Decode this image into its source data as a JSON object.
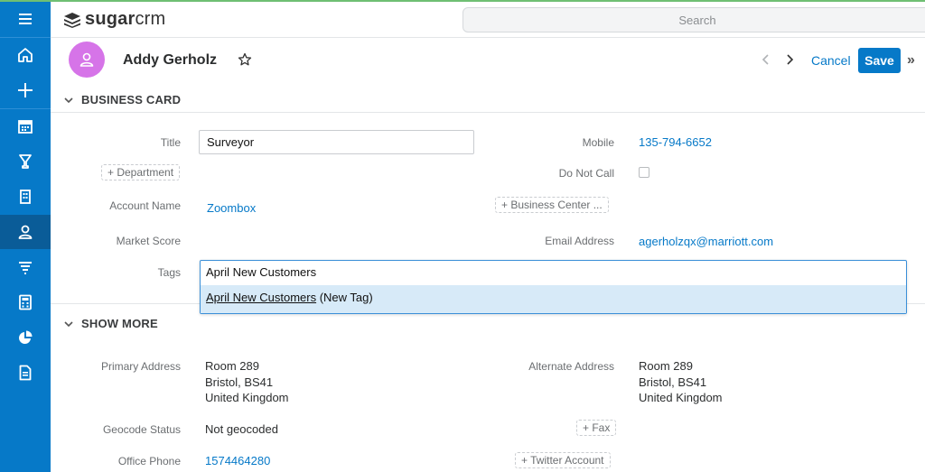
{
  "header": {
    "logo_text_bold": "sugar",
    "logo_text": "crm",
    "search_placeholder": "Search"
  },
  "sidebar": {
    "items": [
      {
        "icon": "menu-icon"
      },
      {
        "icon": "home-icon"
      },
      {
        "icon": "plus-icon"
      },
      {
        "icon": "calendar-icon"
      },
      {
        "icon": "opportunities-icon"
      },
      {
        "icon": "building-icon"
      },
      {
        "icon": "contacts-icon",
        "active": true
      },
      {
        "icon": "filter-icon"
      },
      {
        "icon": "calculator-icon"
      },
      {
        "icon": "pie-chart-icon"
      },
      {
        "icon": "document-icon"
      }
    ],
    "active_color": "#0a5c98",
    "bg_color": "#0679c8"
  },
  "record": {
    "name": "Addy Gerholz",
    "cancel_label": "Cancel",
    "save_label": "Save",
    "more_label": "»"
  },
  "business_card": {
    "section_title": "BUSINESS CARD",
    "title_label": "Title",
    "title_value": "Surveyor",
    "mobile_label": "Mobile",
    "mobile_value": "135-794-6652",
    "department_pill": "+ Department",
    "do_not_call_label": "Do Not Call",
    "account_name_label": "Account Name",
    "account_name_value": "Zoombox",
    "business_center_pill": "+ Business Center ...",
    "market_score_label": "Market Score",
    "email_label": "Email Address",
    "email_value": "agerholzqx@marriott.com",
    "tags_label": "Tags",
    "tags_input_value": "April New Customers",
    "tags_option_text": "April New Customers",
    "tags_option_suffix": " (New Tag)"
  },
  "show_more": {
    "section_title": "SHOW MORE",
    "primary_address_label": "Primary Address",
    "primary_address_line1": "Room 289",
    "primary_address_line2": "Bristol, BS41",
    "primary_address_line3": "United Kingdom",
    "alternate_address_label": "Alternate Address",
    "alternate_address_line1": "Room 289",
    "alternate_address_line2": "Bristol, BS41",
    "alternate_address_line3": "United Kingdom",
    "geocode_label": "Geocode Status",
    "geocode_value": "Not geocoded",
    "fax_pill": "+ Fax",
    "office_phone_label": "Office Phone",
    "office_phone_value": "1574464280",
    "twitter_pill": "+ Twitter Account"
  }
}
